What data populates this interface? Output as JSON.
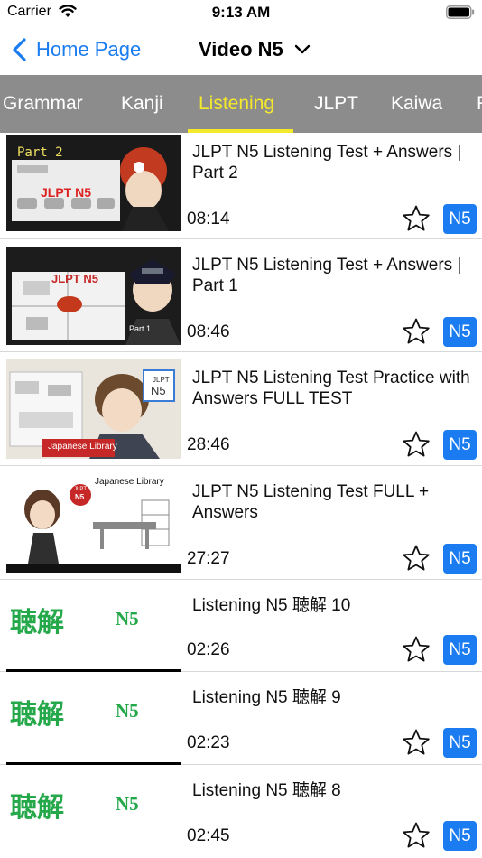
{
  "status": {
    "carrier": "Carrier",
    "time": "9:13 AM"
  },
  "nav": {
    "back_label": "Home Page",
    "title": "Video N5"
  },
  "tabs": [
    "Grammar",
    "Kanji",
    "Listening",
    "JLPT",
    "Kaiwa",
    "F"
  ],
  "active_tab": "Listening",
  "colors": {
    "accent": "#1a7cf0",
    "tab_bar": "#8c8c8c",
    "tab_active": "#f5e92c",
    "kanji_green": "#25a84a"
  },
  "videos": [
    {
      "title": "JLPT N5 Listening Test + Answers | Part 2",
      "duration": "08:14",
      "level": "N5",
      "thumb_text_1": "Part 2",
      "thumb_text_2": "JLPT N5"
    },
    {
      "title": "JLPT N5 Listening Test + Answers | Part 1",
      "duration": "08:46",
      "level": "N5",
      "thumb_text_1": "JLPT N5",
      "thumb_text_2": "Part 1"
    },
    {
      "title": "JLPT N5 Listening Test Practice with Answers FULL TEST",
      "duration": "28:46",
      "level": "N5",
      "thumb_text_1": "JLPT",
      "thumb_text_2": "N5",
      "thumb_text_3": "Japanese Library"
    },
    {
      "title": "JLPT N5 Listening Test FULL + Answers",
      "duration": "27:27",
      "level": "N5",
      "thumb_text_1": "Japanese Library",
      "thumb_text_2": "JLPT",
      "thumb_text_3": "N5"
    },
    {
      "title": "Listening N5 聴解 10",
      "duration": "02:26",
      "level": "N5",
      "thumb_kanji": "聴解",
      "thumb_level": "N5"
    },
    {
      "title": "Listening N5 聴解 9",
      "duration": "02:23",
      "level": "N5",
      "thumb_kanji": "聴解",
      "thumb_level": "N5"
    },
    {
      "title": "Listening N5 聴解 8",
      "duration": "02:45",
      "level": "N5",
      "thumb_kanji": "聴解",
      "thumb_level": "N5"
    }
  ],
  "icons": [
    "wifi-icon",
    "battery-icon",
    "back-chevron-icon",
    "dropdown-chevron-icon",
    "star-icon"
  ]
}
